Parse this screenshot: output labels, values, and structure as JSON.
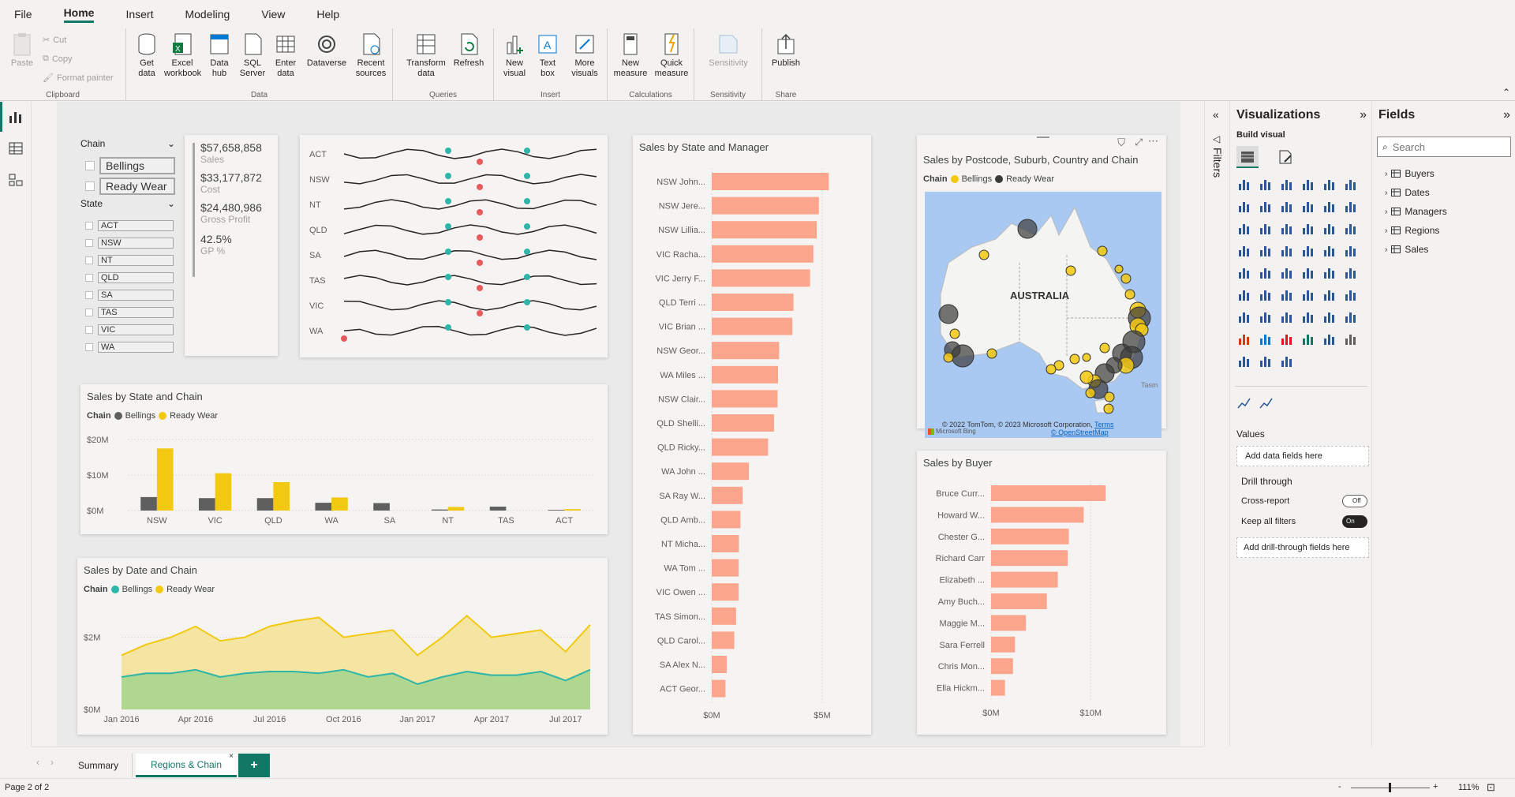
{
  "menu": [
    "File",
    "Home",
    "Insert",
    "Modeling",
    "View",
    "Help"
  ],
  "ribbon": {
    "clipboard": {
      "paste": "Paste",
      "cut": "Cut",
      "copy": "Copy",
      "format_painter": "Format painter",
      "label": "Clipboard"
    },
    "data": {
      "buttons": [
        "Get data",
        "Excel workbook",
        "Data hub",
        "SQL Server",
        "Enter data",
        "Dataverse",
        "Recent sources"
      ],
      "label": "Data"
    },
    "queries": {
      "buttons": [
        "Transform data",
        "Refresh"
      ],
      "label": "Queries"
    },
    "insert": {
      "buttons": [
        "New visual",
        "Text box",
        "More visuals"
      ],
      "label": "Insert"
    },
    "calculations": {
      "buttons": [
        "New measure",
        "Quick measure"
      ],
      "label": "Calculations"
    },
    "sensitivity": {
      "buttons": [
        "Sensitivity"
      ],
      "label": "Sensitivity"
    },
    "share": {
      "buttons": [
        "Publish"
      ],
      "label": "Share"
    }
  },
  "slicers": {
    "chain_title": "Chain",
    "chain_items": [
      "Bellings",
      "Ready Wear"
    ],
    "state_title": "State",
    "state_items": [
      "ACT",
      "NSW",
      "NT",
      "QLD",
      "SA",
      "TAS",
      "VIC",
      "WA"
    ]
  },
  "kpis": [
    {
      "value": "$57,658,858",
      "label": "Sales"
    },
    {
      "value": "$33,177,872",
      "label": "Cost"
    },
    {
      "value": "$24,480,986",
      "label": "Gross Profit"
    },
    {
      "value": "42.5%",
      "label": "GP %"
    }
  ],
  "sparklines": {
    "states": [
      "ACT",
      "NSW",
      "NT",
      "QLD",
      "SA",
      "TAS",
      "VIC",
      "WA"
    ]
  },
  "state_chain": {
    "title": "Sales by State and Chain",
    "legend_title": "Chain",
    "colors": {
      "Bellings": "#5f5f5f",
      "Ready Wear": "#f2c811"
    },
    "chart_data": {
      "type": "bar",
      "categories": [
        "NSW",
        "VIC",
        "QLD",
        "WA",
        "SA",
        "NT",
        "TAS",
        "ACT"
      ],
      "series": [
        {
          "name": "Bellings",
          "values": [
            3.8,
            3.5,
            3.5,
            2.2,
            2.1,
            0.3,
            1.1,
            0.2
          ]
        },
        {
          "name": "Ready Wear",
          "values": [
            17.5,
            10.5,
            8,
            3.7,
            0,
            1,
            0,
            0.4
          ]
        }
      ],
      "ylabel": "",
      "yticks": [
        "$0M",
        "$10M",
        "$20M"
      ],
      "ylim": [
        0,
        20
      ]
    }
  },
  "date_chain": {
    "title": "Sales by Date and Chain",
    "legend_title": "Chain",
    "colors": {
      "Bellings": "#2cb5a8",
      "Ready Wear": "#f2c811"
    },
    "chart_data": {
      "type": "area",
      "x": [
        "Jan 2016",
        "Feb 2016",
        "Mar 2016",
        "Apr 2016",
        "May 2016",
        "Jun 2016",
        "Jul 2016",
        "Aug 2016",
        "Sep 2016",
        "Oct 2016",
        "Nov 2016",
        "Dec 2016",
        "Jan 2017",
        "Feb 2017",
        "Mar 2017",
        "Apr 2017",
        "May 2017",
        "Jun 2017",
        "Jul 2017",
        "Aug 2017"
      ],
      "xticks": [
        "Jan 2016",
        "Apr 2016",
        "Jul 2016",
        "Oct 2016",
        "Jan 2017",
        "Apr 2017",
        "Jul 2017"
      ],
      "series": [
        {
          "name": "Bellings",
          "values": [
            0.9,
            1.0,
            1.0,
            1.1,
            0.9,
            1.0,
            1.05,
            1.05,
            1.0,
            1.1,
            0.9,
            1.0,
            0.7,
            0.9,
            1.05,
            0.95,
            0.95,
            1.05,
            0.8,
            1.1
          ]
        },
        {
          "name": "Ready Wear",
          "values": [
            1.5,
            1.8,
            2.0,
            2.3,
            1.9,
            2.0,
            2.3,
            2.45,
            2.55,
            2.0,
            2.1,
            2.2,
            1.5,
            2.0,
            2.6,
            2.0,
            2.1,
            2.2,
            1.6,
            2.35
          ]
        }
      ],
      "yticks": [
        "$0M",
        "$2M"
      ],
      "ylim": [
        0,
        2.8
      ]
    }
  },
  "state_manager": {
    "title": "Sales by State and Manager",
    "color": "#fba58c",
    "chart_data": {
      "type": "bar",
      "categories": [
        "NSW John...",
        "NSW Jere...",
        "NSW Lillia...",
        "VIC Racha...",
        "VIC Jerry F...",
        "QLD Terri ...",
        "VIC Brian ...",
        "NSW Geor...",
        "WA Miles ...",
        "NSW Clair...",
        "QLD Shelli...",
        "QLD Ricky...",
        "WA John ...",
        "SA Ray W...",
        "QLD Amb...",
        "NT Micha...",
        "WA Tom ...",
        "VIC Owen ...",
        "TAS Simon...",
        "QLD Carol...",
        "SA Alex N...",
        "ACT Geor..."
      ],
      "values": [
        5.3,
        4.85,
        4.75,
        4.6,
        4.45,
        3.7,
        3.65,
        3.05,
        3.0,
        2.98,
        2.82,
        2.55,
        1.68,
        1.4,
        1.3,
        1.23,
        1.22,
        1.22,
        1.1,
        1.02,
        0.68,
        0.62
      ],
      "xticks": [
        "$0M",
        "$5M"
      ],
      "xlim": [
        0,
        6.5
      ]
    }
  },
  "map": {
    "title": "Sales by Postcode, Suburb, Country and Chain",
    "legend_title": "Chain",
    "legend": [
      "Bellings",
      "Ready Wear"
    ],
    "colors": {
      "Bellings": "#f2c811",
      "Ready Wear": "#3b3b3b"
    },
    "country_label": "AUSTRALIA",
    "copyright": "© 2022 TomTom, © 2023 Microsoft Corporation,",
    "terms": "Terms",
    "osm": "© OpenStreetMap",
    "bing": "Microsoft Bing",
    "tasman": "Tasm"
  },
  "buyer": {
    "title": "Sales by Buyer",
    "color": "#fba58c",
    "chart_data": {
      "type": "bar",
      "categories": [
        "Bruce Curr...",
        "Howard W...",
        "Chester G...",
        "Richard Carr",
        "Elizabeth ...",
        "Amy Buch...",
        "Maggie M...",
        "Sara Ferrell",
        "Chris Mon...",
        "Ella Hickm..."
      ],
      "values": [
        11.5,
        9.3,
        7.8,
        7.7,
        6.7,
        5.6,
        3.5,
        2.4,
        2.2,
        1.4
      ],
      "xticks": [
        "$0M",
        "$10M"
      ],
      "xlim": [
        0,
        16
      ]
    }
  },
  "filters_label": "Filters",
  "viz": {
    "title": "Visualizations",
    "build": "Build visual",
    "values": "Values",
    "add_fields": "Add data fields here",
    "drill": "Drill through",
    "cross": "Cross-report",
    "cross_state": "Off",
    "keep": "Keep all filters",
    "keep_state": "On",
    "add_drill": "Add drill-through fields here"
  },
  "fields": {
    "title": "Fields",
    "search_placeholder": "Search",
    "tables": [
      "Buyers",
      "Dates",
      "Managers",
      "Regions",
      "Sales"
    ]
  },
  "tabs": [
    {
      "label": "Summary"
    },
    {
      "label": "Regions & Chain"
    }
  ],
  "status": {
    "page": "Page 2 of 2",
    "zoom": "111%"
  }
}
